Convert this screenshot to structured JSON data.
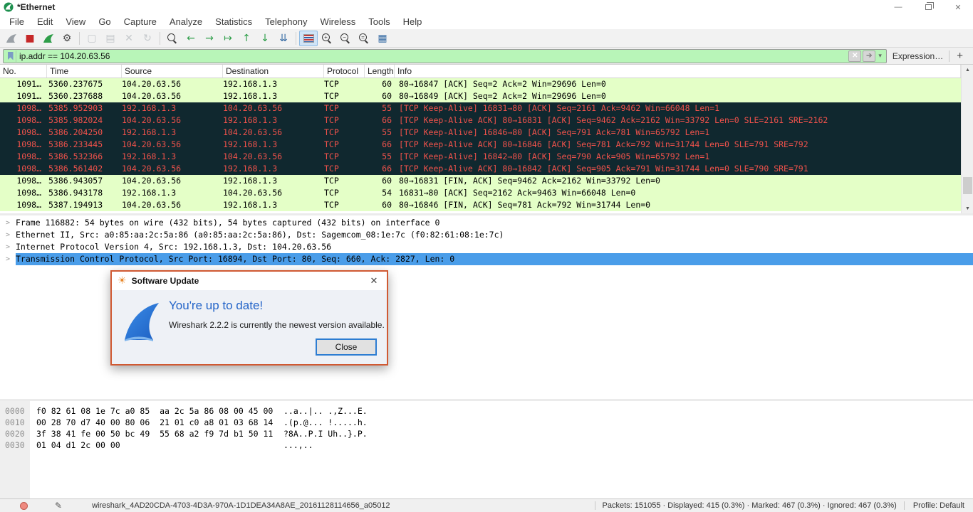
{
  "window": {
    "title": "*Ethernet"
  },
  "menu": {
    "items": [
      "File",
      "Edit",
      "View",
      "Go",
      "Capture",
      "Analyze",
      "Statistics",
      "Telephony",
      "Wireless",
      "Tools",
      "Help"
    ]
  },
  "toolbar": {
    "icons": [
      {
        "name": "start-capture-icon",
        "fin": "#9aa0a6"
      },
      {
        "name": "stop-capture-icon",
        "glyph": "■",
        "color": "#c62828"
      },
      {
        "name": "restart-capture-icon",
        "fin": "#2e9e49"
      },
      {
        "name": "capture-options-icon",
        "glyph": "⚙",
        "color": "#4a4a4a",
        "sep_after": true
      },
      {
        "name": "open-file-icon",
        "glyph": "▢",
        "color": "#7d8890",
        "disabled": true
      },
      {
        "name": "save-file-icon",
        "glyph": "▤",
        "color": "#7d8890",
        "disabled": true
      },
      {
        "name": "close-file-icon",
        "glyph": "✕",
        "color": "#7d8890",
        "disabled": true
      },
      {
        "name": "reload-file-icon",
        "glyph": "↻",
        "color": "#7d8890",
        "disabled": true,
        "sep_after": true
      },
      {
        "name": "find-packet-icon",
        "mag": ""
      },
      {
        "name": "go-back-icon",
        "glyph": "←",
        "color": "#2e9e49"
      },
      {
        "name": "go-forward-icon",
        "glyph": "→",
        "color": "#2e9e49"
      },
      {
        "name": "go-to-packet-icon",
        "glyph": "↦",
        "color": "#2e9e49"
      },
      {
        "name": "go-first-icon",
        "glyph": "↑",
        "color": "#2e9e49"
      },
      {
        "name": "go-last-icon",
        "glyph": "↓",
        "color": "#2e9e49"
      },
      {
        "name": "auto-scroll-icon",
        "glyph": "⇊",
        "color": "#3a6ea5",
        "sep_after": true
      },
      {
        "name": "colorize-icon",
        "bars": true,
        "active": true
      },
      {
        "name": "zoom-in-icon",
        "mag": "+"
      },
      {
        "name": "zoom-out-icon",
        "mag": "−"
      },
      {
        "name": "zoom-reset-icon",
        "mag": "="
      },
      {
        "name": "resize-columns-icon",
        "glyph": "▦",
        "color": "#3a6ea5"
      }
    ]
  },
  "filter": {
    "value": "ip.addr == 104.20.63.56",
    "clear_label": "✕",
    "apply_label": "➔",
    "caret": "▾",
    "expression_label": "Expression…",
    "add_label": "+",
    "valid_color": "#b8f5b8"
  },
  "packet_list": {
    "columns": [
      "No.",
      "Time",
      "Source",
      "Destination",
      "Protocol",
      "Length",
      "Info"
    ],
    "colors": {
      "good_row": "#e4ffc7",
      "bad_row_bg": "#10282f",
      "bad_row_text": "#f0524b",
      "selection": "#4a9de9"
    },
    "rows": [
      {
        "no": "1091…",
        "time": "5360.237675",
        "source": "104.20.63.56",
        "destination": "192.168.1.3",
        "protocol": "TCP",
        "length": "60",
        "info": "80→16847 [ACK] Seq=2 Ack=2 Win=29696 Len=0",
        "style": "green"
      },
      {
        "no": "1091…",
        "time": "5360.237688",
        "source": "104.20.63.56",
        "destination": "192.168.1.3",
        "protocol": "TCP",
        "length": "60",
        "info": "80→16849 [ACK] Seq=2 Ack=2 Win=29696 Len=0",
        "style": "green"
      },
      {
        "no": "1098…",
        "time": "5385.952903",
        "source": "192.168.1.3",
        "destination": "104.20.63.56",
        "protocol": "TCP",
        "length": "55",
        "info": "[TCP Keep-Alive] 16831→80 [ACK] Seq=2161 Ack=9462 Win=66048 Len=1",
        "style": "dark"
      },
      {
        "no": "1098…",
        "time": "5385.982024",
        "source": "104.20.63.56",
        "destination": "192.168.1.3",
        "protocol": "TCP",
        "length": "66",
        "info": "[TCP Keep-Alive ACK] 80→16831 [ACK] Seq=9462 Ack=2162 Win=33792 Len=0 SLE=2161 SRE=2162",
        "style": "dark"
      },
      {
        "no": "1098…",
        "time": "5386.204250",
        "source": "192.168.1.3",
        "destination": "104.20.63.56",
        "protocol": "TCP",
        "length": "55",
        "info": "[TCP Keep-Alive] 16846→80 [ACK] Seq=791 Ack=781 Win=65792 Len=1",
        "style": "dark"
      },
      {
        "no": "1098…",
        "time": "5386.233445",
        "source": "104.20.63.56",
        "destination": "192.168.1.3",
        "protocol": "TCP",
        "length": "66",
        "info": "[TCP Keep-Alive ACK] 80→16846 [ACK] Seq=781 Ack=792 Win=31744 Len=0 SLE=791 SRE=792",
        "style": "dark"
      },
      {
        "no": "1098…",
        "time": "5386.532366",
        "source": "192.168.1.3",
        "destination": "104.20.63.56",
        "protocol": "TCP",
        "length": "55",
        "info": "[TCP Keep-Alive] 16842→80 [ACK] Seq=790 Ack=905 Win=65792 Len=1",
        "style": "dark"
      },
      {
        "no": "1098…",
        "time": "5386.561402",
        "source": "104.20.63.56",
        "destination": "192.168.1.3",
        "protocol": "TCP",
        "length": "66",
        "info": "[TCP Keep-Alive ACK] 80→16842 [ACK] Seq=905 Ack=791 Win=31744 Len=0 SLE=790 SRE=791",
        "style": "dark"
      },
      {
        "no": "1098…",
        "time": "5386.943057",
        "source": "104.20.63.56",
        "destination": "192.168.1.3",
        "protocol": "TCP",
        "length": "60",
        "info": "80→16831 [FIN, ACK] Seq=9462 Ack=2162 Win=33792 Len=0",
        "style": "green"
      },
      {
        "no": "1098…",
        "time": "5386.943178",
        "source": "192.168.1.3",
        "destination": "104.20.63.56",
        "protocol": "TCP",
        "length": "54",
        "info": "16831→80 [ACK] Seq=2162 Ack=9463 Win=66048 Len=0",
        "style": "green"
      },
      {
        "no": "1098…",
        "time": "5387.194913",
        "source": "104.20.63.56",
        "destination": "192.168.1.3",
        "protocol": "TCP",
        "length": "60",
        "info": "80→16846 [FIN, ACK] Seq=781 Ack=792 Win=31744 Len=0",
        "style": "green"
      }
    ]
  },
  "detail": {
    "lines": [
      {
        "text": "Frame 116882: 54 bytes on wire (432 bits), 54 bytes captured (432 bits) on interface 0",
        "selected": false
      },
      {
        "text": "Ethernet II, Src: a0:85:aa:2c:5a:86 (a0:85:aa:2c:5a:86), Dst: Sagemcom_08:1e:7c (f0:82:61:08:1e:7c)",
        "selected": false
      },
      {
        "text": "Internet Protocol Version 4, Src: 192.168.1.3, Dst: 104.20.63.56",
        "selected": false
      },
      {
        "text": "Transmission Control Protocol, Src Port: 16894, Dst Port: 80, Seq: 660, Ack: 2827, Len: 0",
        "selected": true
      }
    ]
  },
  "hex": {
    "rows": [
      {
        "offset": "0000",
        "bytes": "f0 82 61 08 1e 7c a0 85  aa 2c 5a 86 08 00 45 00",
        "ascii": "..a..|.. .,Z...E."
      },
      {
        "offset": "0010",
        "bytes": "00 28 70 d7 40 00 80 06  21 01 c0 a8 01 03 68 14",
        "ascii": ".(p.@... !.....h."
      },
      {
        "offset": "0020",
        "bytes": "3f 38 41 fe 00 50 bc 49  55 68 a2 f9 7d b1 50 11",
        "ascii": "?8A..P.I Uh..}.P."
      },
      {
        "offset": "0030",
        "bytes": "01 04 d1 2c 00 00",
        "ascii": "...,.."
      }
    ]
  },
  "dialog": {
    "title": "Software Update",
    "heading": "You're up to date!",
    "message": "Wireshark 2.2.2 is currently the newest version available.",
    "close_label": "Close",
    "accent_color": "#2364c8",
    "border_color": "#d05932"
  },
  "status": {
    "filename": "wireshark_4AD20CDA-4703-4D3A-970A-1D1DEA34A8AE_20161128114656_a05012",
    "stats": "Packets: 151055 · Displayed: 415 (0.3%) · Marked: 467 (0.3%) · Ignored: 467 (0.3%)",
    "profile": "Profile: Default"
  }
}
